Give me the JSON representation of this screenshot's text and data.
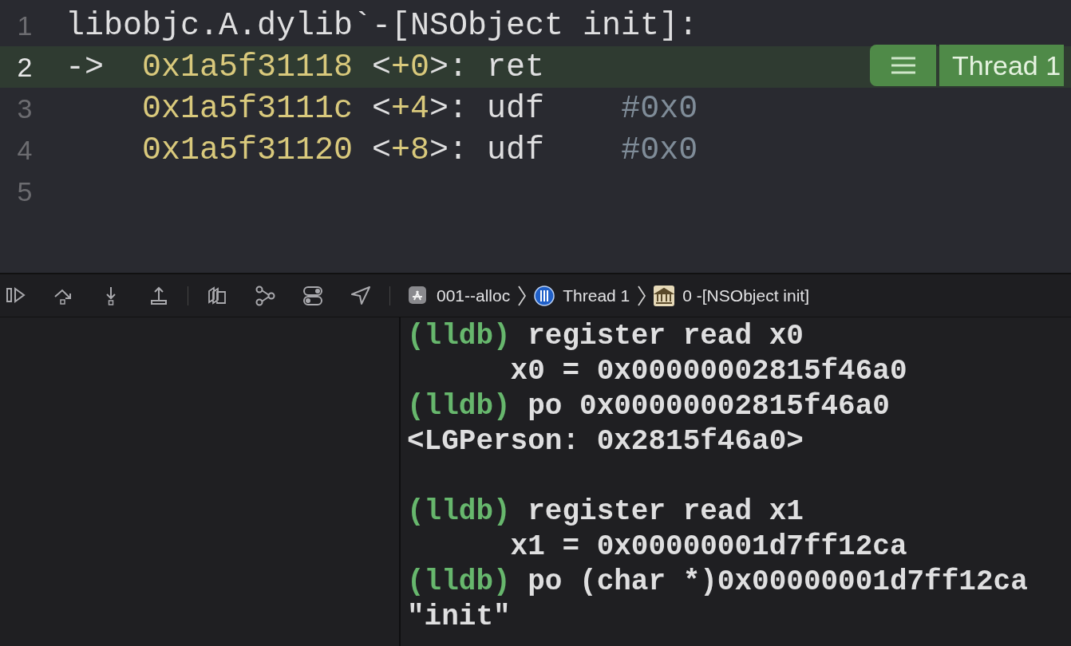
{
  "editor": {
    "lines": [
      {
        "number": "1",
        "kind": "header",
        "current": false,
        "segments": [
          {
            "kind": "plain",
            "text": "libobjc.A.dylib`-[NSObject init]:"
          }
        ]
      },
      {
        "number": "2",
        "kind": "instruction",
        "current": true,
        "segments": [
          {
            "kind": "arrow",
            "text": "->"
          },
          {
            "kind": "address",
            "text": "0x1a5f31118"
          },
          {
            "kind": "plain",
            "text": " <"
          },
          {
            "kind": "number",
            "text": "+0"
          },
          {
            "kind": "plain",
            "text": ">: ret"
          }
        ]
      },
      {
        "number": "3",
        "kind": "instruction",
        "current": false,
        "segments": [
          {
            "kind": "address",
            "text": "0x1a5f3111c"
          },
          {
            "kind": "plain",
            "text": " <"
          },
          {
            "kind": "number",
            "text": "+4"
          },
          {
            "kind": "plain",
            "text": ">: udf    "
          },
          {
            "kind": "comment",
            "text": "#0x0"
          }
        ]
      },
      {
        "number": "4",
        "kind": "instruction",
        "current": false,
        "segments": [
          {
            "kind": "address",
            "text": "0x1a5f31120"
          },
          {
            "kind": "plain",
            "text": " <"
          },
          {
            "kind": "number",
            "text": "+8"
          },
          {
            "kind": "plain",
            "text": ">: udf    "
          },
          {
            "kind": "comment",
            "text": "#0x0"
          }
        ]
      },
      {
        "number": "5",
        "kind": "blank",
        "current": false
      }
    ],
    "thread_badge": {
      "label": "Thread 1"
    }
  },
  "debug_bar": {
    "tools": [
      {
        "kind": "toggle"
      },
      {
        "kind": "step-over"
      },
      {
        "kind": "step-into"
      },
      {
        "kind": "step-out"
      },
      {
        "kind": "layers"
      },
      {
        "kind": "graph"
      },
      {
        "kind": "switches"
      },
      {
        "kind": "location"
      }
    ],
    "breadcrumbs": [
      {
        "kind": "app",
        "label": "001--alloc"
      },
      {
        "kind": "thread",
        "label": "Thread 1"
      },
      {
        "kind": "frame",
        "label": "0 -[NSObject init]"
      }
    ]
  },
  "console": {
    "lines": [
      {
        "kind": "text",
        "segments": [
          {
            "kind": "prompt",
            "text": "(lldb)"
          },
          {
            "kind": "plain",
            "text": " register read x0"
          }
        ]
      },
      {
        "kind": "text",
        "segments": [
          {
            "kind": "plain",
            "text": "      x0 = 0x00000002815f46a0"
          }
        ]
      },
      {
        "kind": "text",
        "segments": [
          {
            "kind": "prompt",
            "text": "(lldb)"
          },
          {
            "kind": "plain",
            "text": " po 0x00000002815f46a0"
          }
        ]
      },
      {
        "kind": "text",
        "segments": [
          {
            "kind": "plain",
            "text": "<LGPerson: 0x2815f46a0>"
          }
        ]
      },
      {
        "kind": "blank"
      },
      {
        "kind": "text",
        "segments": [
          {
            "kind": "prompt",
            "text": "(lldb)"
          },
          {
            "kind": "plain",
            "text": " register read x1"
          }
        ]
      },
      {
        "kind": "text",
        "segments": [
          {
            "kind": "plain",
            "text": "      x1 = 0x00000001d7ff12ca"
          }
        ]
      },
      {
        "kind": "text",
        "segments": [
          {
            "kind": "prompt",
            "text": "(lldb)"
          },
          {
            "kind": "plain",
            "text": " po (char *)0x00000001d7ff12ca"
          }
        ]
      },
      {
        "kind": "text",
        "segments": [
          {
            "kind": "plain",
            "text": "\"init\""
          }
        ]
      }
    ]
  }
}
